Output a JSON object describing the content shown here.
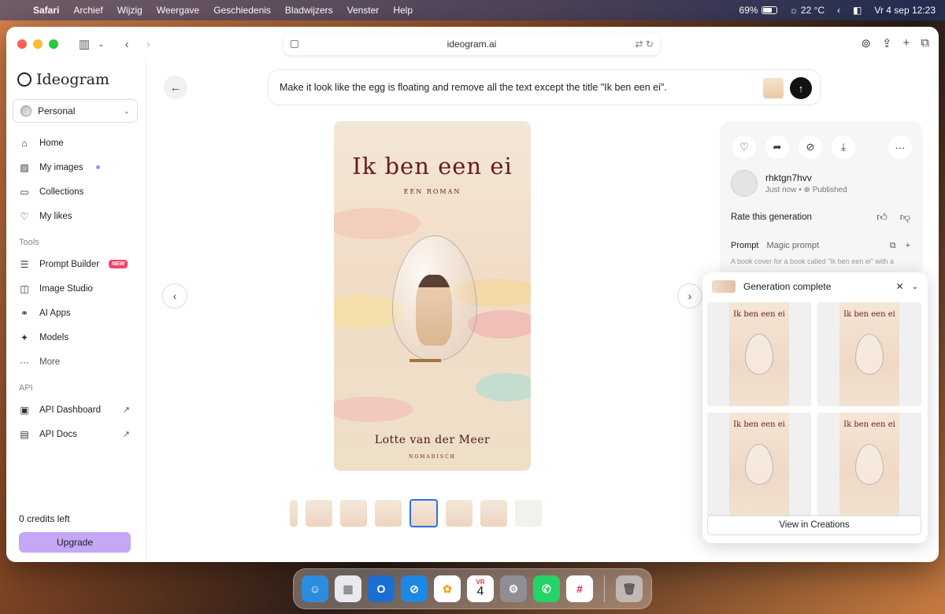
{
  "menubar": {
    "items": [
      "Safari",
      "Archief",
      "Wijzig",
      "Weergave",
      "Geschiedenis",
      "Bladwijzers",
      "Venster",
      "Help"
    ],
    "battery": "69%",
    "battery_level": 0.69,
    "weather": "22 °C",
    "datetime": "Vr 4 sep  12:23"
  },
  "browser": {
    "url": "ideogram.ai"
  },
  "sidebar": {
    "logo": "Ideogram",
    "workspace": "Personal",
    "nav": [
      {
        "label": "Home",
        "icon": "home-icon",
        "glyph": "⌂"
      },
      {
        "label": "My images",
        "icon": "images-icon",
        "glyph": "▨"
      },
      {
        "label": "Collections",
        "icon": "folder-icon",
        "glyph": "▭"
      },
      {
        "label": "My likes",
        "icon": "heart-icon",
        "glyph": "♡"
      }
    ],
    "tools_label": "Tools",
    "tools": [
      {
        "label": "Prompt Builder",
        "icon": "prompt-builder-icon",
        "glyph": "☰",
        "badge": "NEW"
      },
      {
        "label": "Image Studio",
        "icon": "image-studio-icon",
        "glyph": "◫"
      },
      {
        "label": "AI Apps",
        "icon": "ai-apps-icon",
        "glyph": "⚭"
      },
      {
        "label": "Models",
        "icon": "models-icon",
        "glyph": "✦"
      },
      {
        "label": "More",
        "icon": "more-icon",
        "glyph": "···"
      }
    ],
    "api_label": "API",
    "api": [
      {
        "label": "API Dashboard",
        "icon": "terminal-icon",
        "glyph": "▣"
      },
      {
        "label": "API Docs",
        "icon": "docs-icon",
        "glyph": "▤"
      }
    ],
    "credits": "0 credits left",
    "upgrade": "Upgrade",
    "username": "rhktgn7hvv"
  },
  "main": {
    "prompt": "Make it look like the egg is floating and remove all the text except the title \"Ik ben een ei\".",
    "cover": {
      "title": "Ik ben een ei",
      "subtitle": "EEN ROMAN",
      "author": "Lotte van der Meer",
      "publisher": "NOMADISCH"
    }
  },
  "info": {
    "author": "rhktgn7hvv",
    "time": "Just now",
    "status": "Published",
    "rate": "Rate this generation",
    "prompt_tab": "Prompt",
    "magic_tab": "Magic prompt",
    "snippet": "A book cover for a book called \"Ik ben een ei\" with a"
  },
  "toast": {
    "title": "Generation complete",
    "image_title": "Ik ben een ei",
    "view_button": "View in Creations"
  },
  "dock": {
    "calendar_month": "VR",
    "calendar_day": "4"
  },
  "colors": {
    "accent": "#c4a7f5",
    "badge": "#ef4468",
    "title": "#6b1a22",
    "selection": "#2f6fe8"
  }
}
